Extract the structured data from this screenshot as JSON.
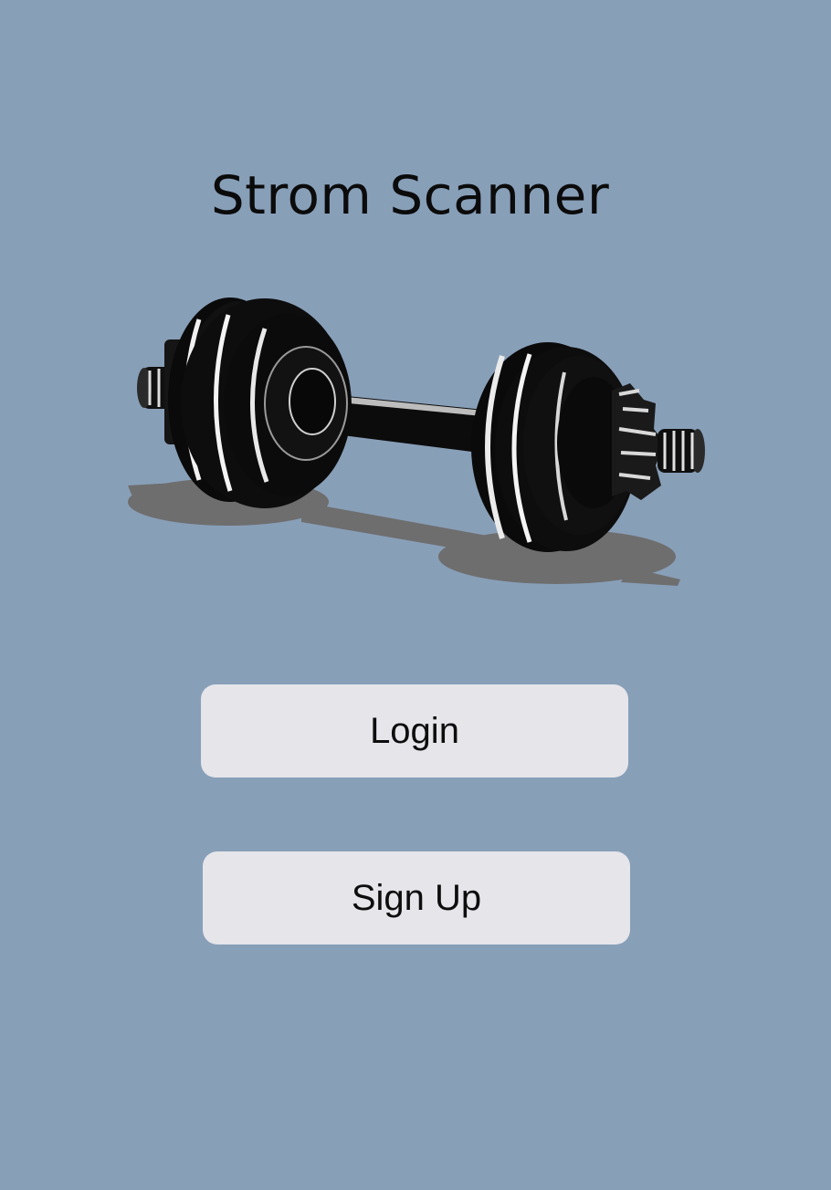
{
  "app": {
    "title": "Strom Scanner",
    "background_color": "#889fb8"
  },
  "logo": {
    "icon": "dumbbell-icon"
  },
  "actions": {
    "login_label": "Login",
    "signup_label": "Sign Up",
    "button_color": "#e5e5ea"
  }
}
